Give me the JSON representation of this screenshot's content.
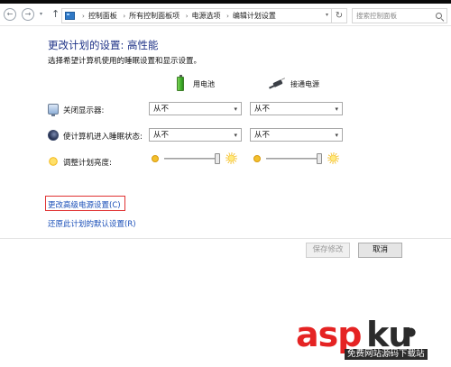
{
  "nav": {
    "back": "←",
    "forward": "→",
    "recent": "▾",
    "up": "↑",
    "breadcrumbs": [
      "控制面板",
      "所有控制面板项",
      "电源选项",
      "编辑计划设置"
    ],
    "separator": "›",
    "address_dropdown": "▾",
    "refresh": "↻",
    "search_placeholder": "搜索控制面板"
  },
  "main": {
    "title": "更改计划的设置: 高性能",
    "description": "选择希望计算机使用的睡眠设置和显示设置。",
    "columns": {
      "battery": "用电池",
      "plugged_in": "接通电源"
    },
    "rows": {
      "display": {
        "label": "关闭显示器:",
        "battery_value": "从不",
        "plugged_value": "从不"
      },
      "sleep": {
        "label": "使计算机进入睡眠状态:",
        "battery_value": "从不",
        "plugged_value": "从不"
      },
      "brightness": {
        "label": "调整计划亮度:",
        "battery_level": 1.0,
        "plugged_level": 1.0
      }
    },
    "dropdown_arrow": "▾",
    "links": {
      "advanced": "更改高级电源设置(C)",
      "restore": "还原此计划的默认设置(R)"
    }
  },
  "footer": {
    "save": "保存修改",
    "cancel": "取消"
  },
  "watermark": {
    "asp": "asp",
    "ku": "ku",
    "dot": "●",
    "sub": "免费网站源码下载站"
  },
  "colors": {
    "title": "#1e3287",
    "link": "#1a4fb8",
    "highlight_box": "#e03232",
    "watermark_red": "#e52323"
  }
}
